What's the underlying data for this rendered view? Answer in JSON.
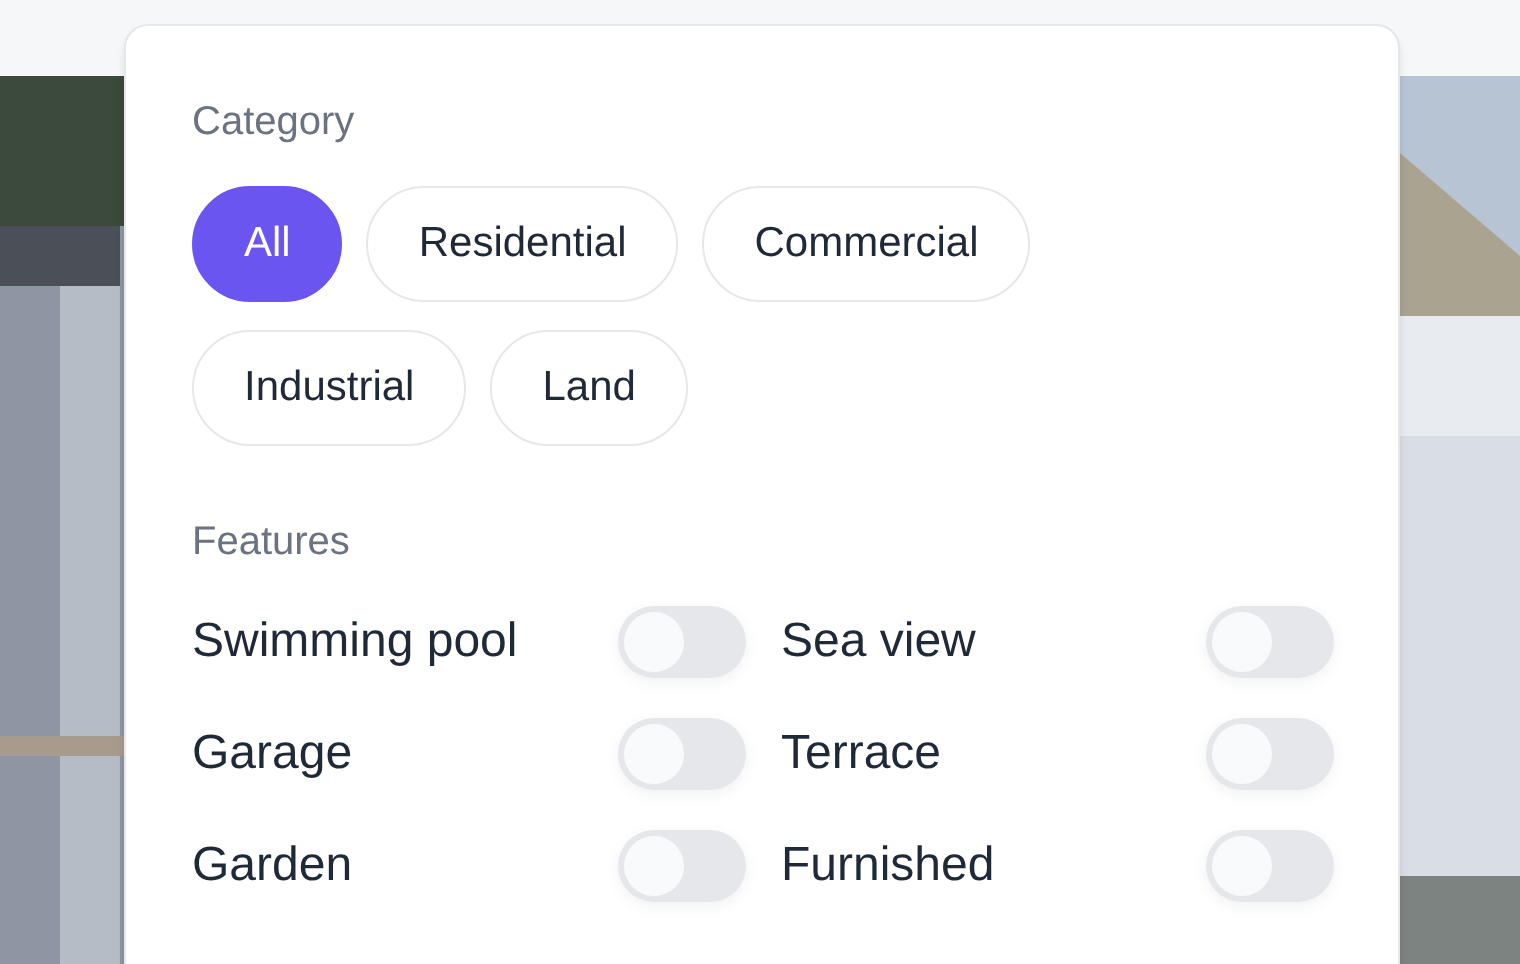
{
  "filter_panel": {
    "category": {
      "title": "Category",
      "options": [
        {
          "label": "All",
          "selected": true
        },
        {
          "label": "Residential",
          "selected": false
        },
        {
          "label": "Commercial",
          "selected": false
        },
        {
          "label": "Industrial",
          "selected": false
        },
        {
          "label": "Land",
          "selected": false
        }
      ]
    },
    "features": {
      "title": "Features",
      "items": [
        {
          "label": "Swimming pool",
          "on": false
        },
        {
          "label": "Sea view",
          "on": false
        },
        {
          "label": "Garage",
          "on": false
        },
        {
          "label": "Terrace",
          "on": false
        },
        {
          "label": "Garden",
          "on": false
        },
        {
          "label": "Furnished",
          "on": false
        }
      ]
    }
  }
}
